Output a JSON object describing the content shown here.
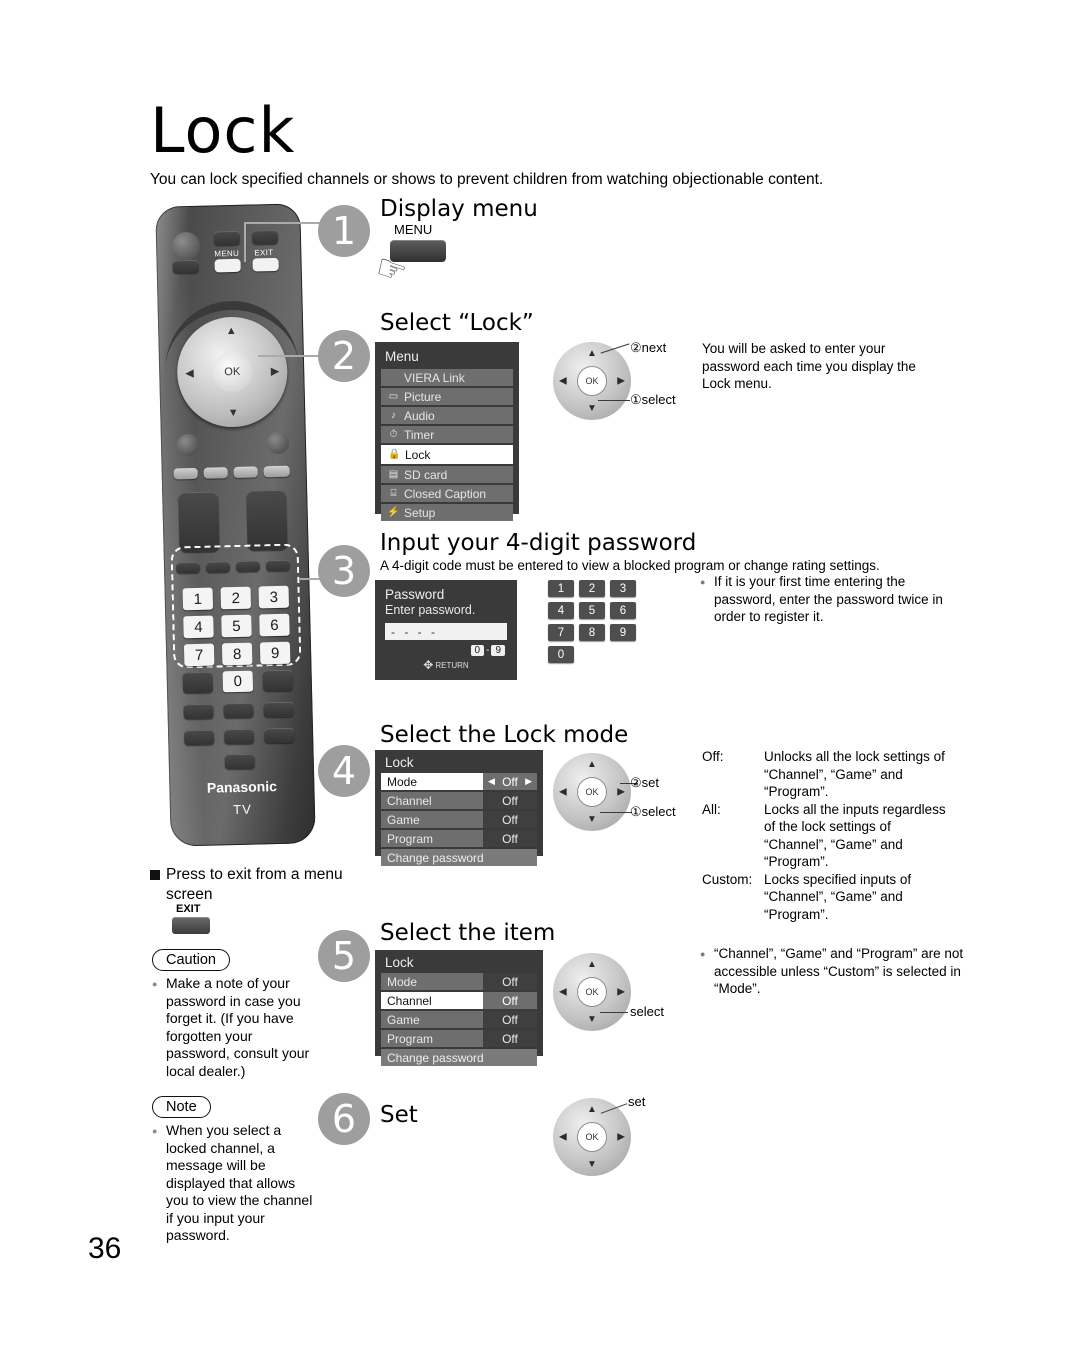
{
  "page": {
    "title": "Lock",
    "intro": "You can lock specified channels or shows to prevent children from watching objectionable content.",
    "number": "36"
  },
  "remote": {
    "brand": "Panasonic",
    "sub": "TV",
    "menu_label": "MENU",
    "exit_label": "EXIT",
    "ok_label": "OK",
    "keys": [
      "1",
      "2",
      "3",
      "4",
      "5",
      "6",
      "7",
      "8",
      "9",
      "0"
    ]
  },
  "steps": [
    {
      "num": "1",
      "heading": "Display menu"
    },
    {
      "num": "2",
      "heading": "Select “Lock”"
    },
    {
      "num": "3",
      "heading": "Input your 4-digit password",
      "subtext": "A 4-digit code must be entered to view a blocked program or change rating settings."
    },
    {
      "num": "4",
      "heading": "Select the Lock mode"
    },
    {
      "num": "5",
      "heading": "Select the item"
    },
    {
      "num": "6",
      "heading": "Set"
    }
  ],
  "step1": {
    "button_label": "MENU"
  },
  "menu_osd": {
    "title": "Menu",
    "items": [
      {
        "icon": "",
        "label": "VIERA Link",
        "selected": false
      },
      {
        "icon": "▭",
        "label": "Picture",
        "selected": false
      },
      {
        "icon": "♪",
        "label": "Audio",
        "selected": false
      },
      {
        "icon": "⏱",
        "label": "Timer",
        "selected": false
      },
      {
        "icon": "🔒",
        "label": "Lock",
        "selected": true
      },
      {
        "icon": "▤",
        "label": "SD card",
        "selected": false
      },
      {
        "icon": "⌸",
        "label": "Closed Caption",
        "selected": false
      },
      {
        "icon": "⚡",
        "label": "Setup",
        "selected": false
      }
    ]
  },
  "step2_dpad": {
    "next": "②next",
    "select": "①select"
  },
  "step2_text": "You will be asked to enter your password each time you display the Lock menu.",
  "password_osd": {
    "title": "Password",
    "prompt": "Enter password.",
    "field_value": "- - - -",
    "range_from": "0",
    "range_dash": "-",
    "range_to": "9",
    "return_label": "RETURN"
  },
  "step3_keypad": [
    "1",
    "2",
    "3",
    "4",
    "5",
    "6",
    "7",
    "8",
    "9",
    "0"
  ],
  "step3_bullet": "If it is your first time entering the password, enter the password twice in order to register it.",
  "lock_osd_step4": {
    "title": "Lock",
    "rows": [
      {
        "name": "Mode",
        "value": "Off",
        "selected": true,
        "arrows": true
      },
      {
        "name": "Channel",
        "value": "Off",
        "selected": false,
        "arrows": false
      },
      {
        "name": "Game",
        "value": "Off",
        "selected": false,
        "arrows": false
      },
      {
        "name": "Program",
        "value": "Off",
        "selected": false,
        "arrows": false
      }
    ],
    "footer": "Change password"
  },
  "lock_osd_step5": {
    "title": "Lock",
    "rows": [
      {
        "name": "Mode",
        "value": "Off",
        "selected": false,
        "arrows": false
      },
      {
        "name": "Channel",
        "value": "Off",
        "selected": true,
        "arrows": false
      },
      {
        "name": "Game",
        "value": "Off",
        "selected": false,
        "arrows": false
      },
      {
        "name": "Program",
        "value": "Off",
        "selected": false,
        "arrows": false
      }
    ],
    "footer": "Change password"
  },
  "step4_dpad": {
    "set": "②set",
    "select": "①select"
  },
  "step5_dpad": {
    "select": "select"
  },
  "step6_dpad": {
    "set": "set"
  },
  "mode_definitions": [
    {
      "key": "Off:",
      "text": "Unlocks all the lock settings of “Channel”, “Game” and “Program”."
    },
    {
      "key": "All:",
      "text": "Locks all the inputs regardless of the lock settings of “Channel”, “Game” and “Program”."
    },
    {
      "key": "Custom:",
      "text": "Locks specified inputs of “Channel”, “Game” and “Program”."
    }
  ],
  "step5_bullet": "“Channel”, “Game” and “Program” are not accessible unless “Custom” is selected in “Mode”.",
  "exit_block": {
    "heading": "Press to exit from a menu screen",
    "key_label": "EXIT"
  },
  "caution": {
    "label": "Caution",
    "body": "Make a note of your password in case you forget it. (If you have forgotten your password, consult your local dealer.)"
  },
  "note": {
    "label": "Note",
    "body": "When you select a locked channel, a message will be displayed that allows you to view the channel if you input your password."
  }
}
